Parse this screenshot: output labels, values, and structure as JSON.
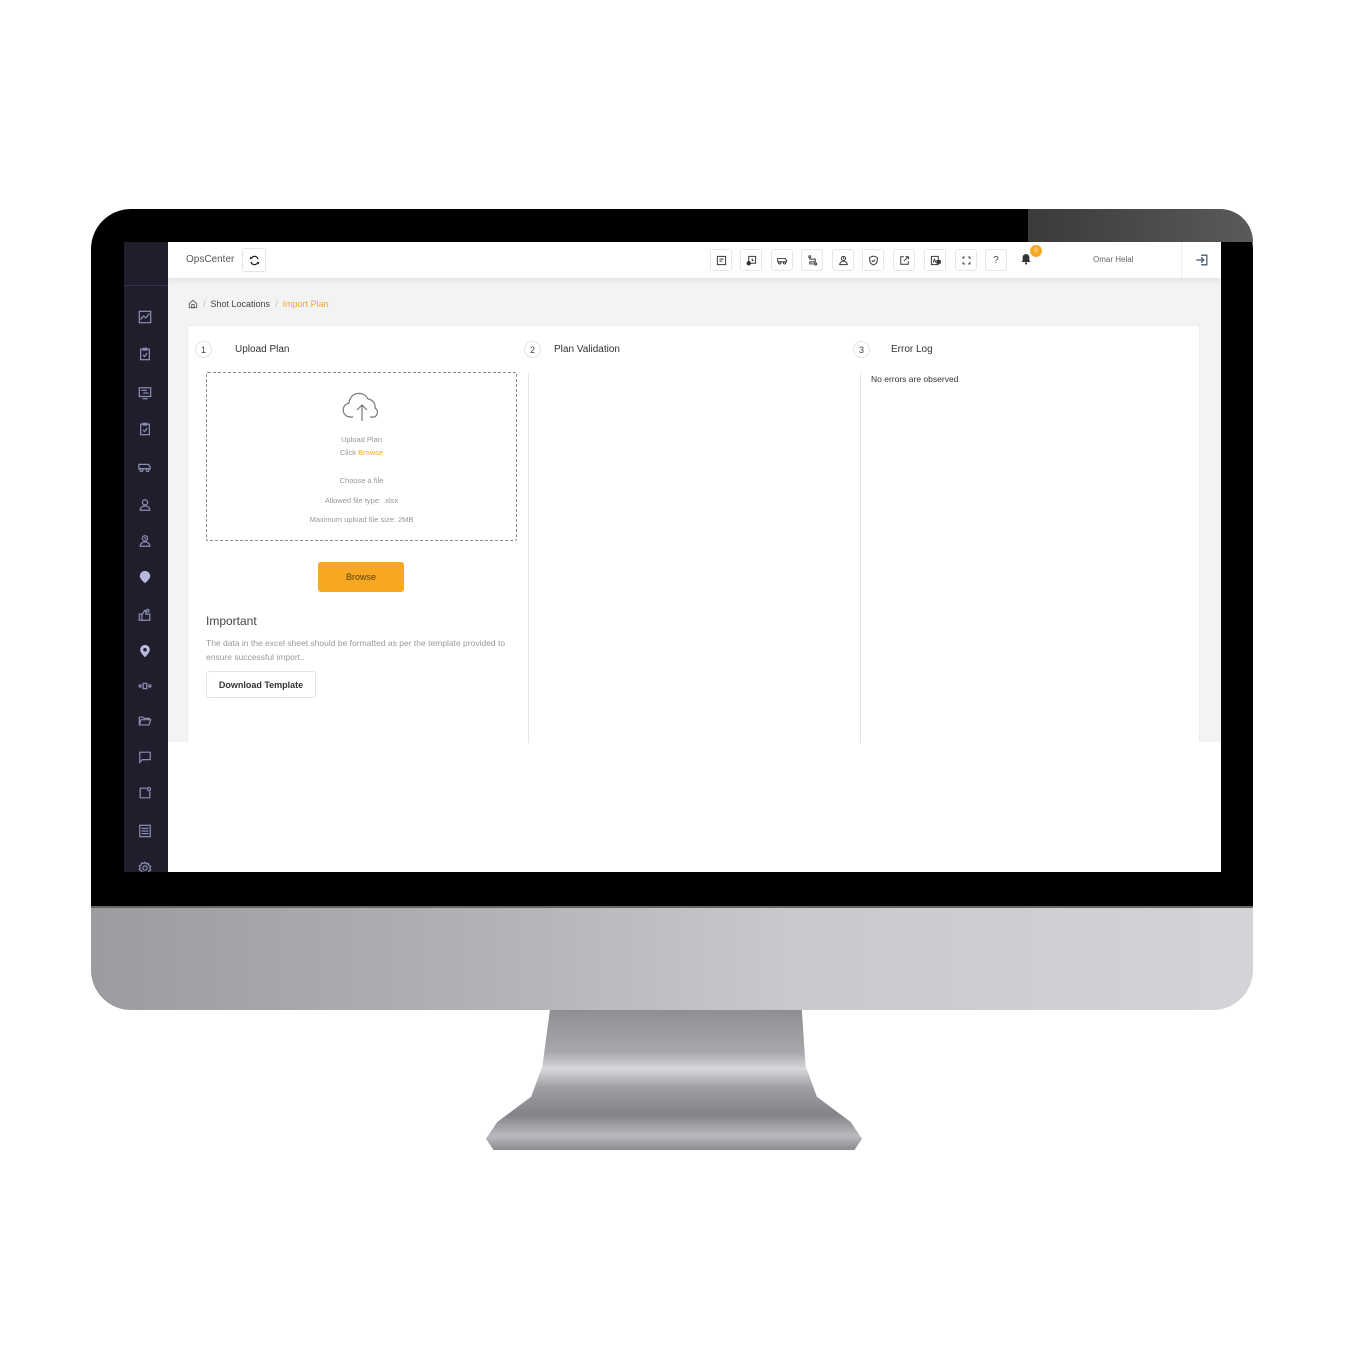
{
  "app": {
    "title": "OpsCenter",
    "user_name": "Omar Helal",
    "notification_count": "0",
    "accent_color": "#f7a823",
    "sidebar_color": "#201e2d"
  },
  "toolbar": {
    "buttons": [
      {
        "icon": "report-icon"
      },
      {
        "icon": "schedule-report-icon"
      },
      {
        "icon": "truck-icon"
      },
      {
        "icon": "route-icon"
      },
      {
        "icon": "user-clock-icon"
      },
      {
        "icon": "shield-check-icon"
      },
      {
        "icon": "external-link-icon"
      },
      {
        "icon": "image-export-icon"
      },
      {
        "icon": "fullscreen-icon"
      },
      {
        "icon": "help-icon",
        "label": "?"
      }
    ]
  },
  "sidebar": {
    "items": [
      {
        "icon": "chart-icon"
      },
      {
        "icon": "clipboard-check-icon"
      },
      {
        "icon": "monitor-icon"
      },
      {
        "icon": "clipboard-check-icon"
      },
      {
        "icon": "truck-icon"
      },
      {
        "icon": "user-icon"
      },
      {
        "icon": "user-clock-icon"
      },
      {
        "icon": "location-clock-icon"
      },
      {
        "icon": "hand-thumb-icon"
      },
      {
        "icon": "map-pin-icon"
      },
      {
        "icon": "broadcast-icon"
      },
      {
        "icon": "folder-open-icon"
      },
      {
        "icon": "message-icon"
      },
      {
        "icon": "notification-square-icon"
      },
      {
        "icon": "list-panel-icon"
      },
      {
        "icon": "settings-icon"
      }
    ]
  },
  "breadcrumb": {
    "items": [
      "Shot Locations",
      "Import Plan"
    ],
    "separator": "/"
  },
  "steps": [
    {
      "number": "1",
      "title": "Upload Plan"
    },
    {
      "number": "2",
      "title": "Plan Validation"
    },
    {
      "number": "3",
      "title": "Error Log"
    }
  ],
  "upload": {
    "heading": "Upload Plan",
    "click_prefix": "Click",
    "click_link": "Browse",
    "choose_file": "Choose a file",
    "allowed_types": "Allowed file type: .xlsx",
    "max_size": "Maximum upload file size: 2MB",
    "browse_button": "Browse",
    "important_title": "Important",
    "important_text": "The data in the excel sheet should be formatted as per the template provided to ensure successful import..",
    "download_button": "Download Template"
  },
  "error_log": {
    "message": "No errors are observed"
  }
}
